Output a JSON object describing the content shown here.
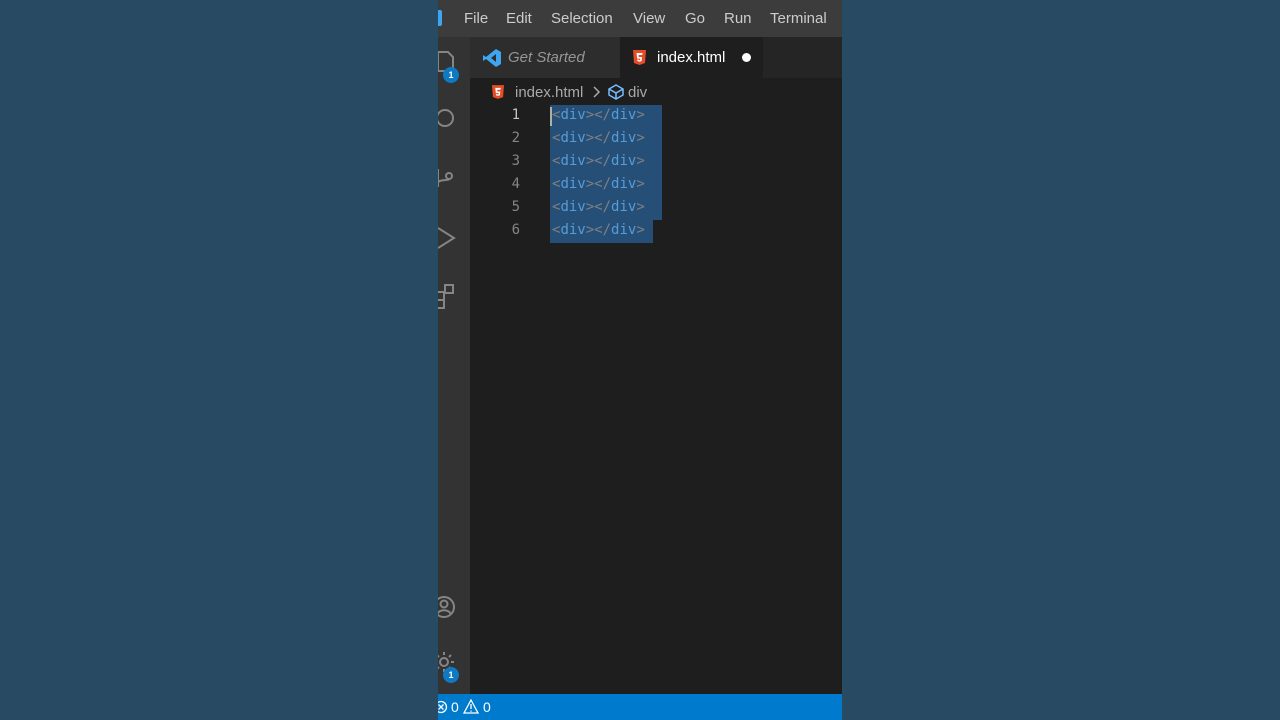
{
  "menu": {
    "items": [
      "File",
      "Edit",
      "Selection",
      "View",
      "Go",
      "Run",
      "Terminal"
    ]
  },
  "activity_bar": {
    "explorer_badge": "1",
    "settings_badge": "1"
  },
  "tabs": [
    {
      "label": "Get Started",
      "active": false
    },
    {
      "label": "index.html",
      "active": true,
      "dirty": true
    }
  ],
  "breadcrumb": {
    "file": "index.html",
    "symbol": "div"
  },
  "editor": {
    "line_numbers": [
      "1",
      "2",
      "3",
      "4",
      "5",
      "6"
    ],
    "lines": [
      {
        "open": "div",
        "close": "div"
      },
      {
        "open": "div",
        "close": "div"
      },
      {
        "open": "div",
        "close": "div"
      },
      {
        "open": "div",
        "close": "div"
      },
      {
        "open": "div",
        "close": "div"
      },
      {
        "open": "div",
        "close": "div"
      }
    ]
  },
  "status_bar": {
    "errors": "0",
    "warnings": "0"
  },
  "colors": {
    "background": "#284a63",
    "editor_bg": "#1e1e1e",
    "selection": "#264f78",
    "statusbar": "#007acc",
    "tag": "#569cd6",
    "html_icon": "#e44d26"
  }
}
